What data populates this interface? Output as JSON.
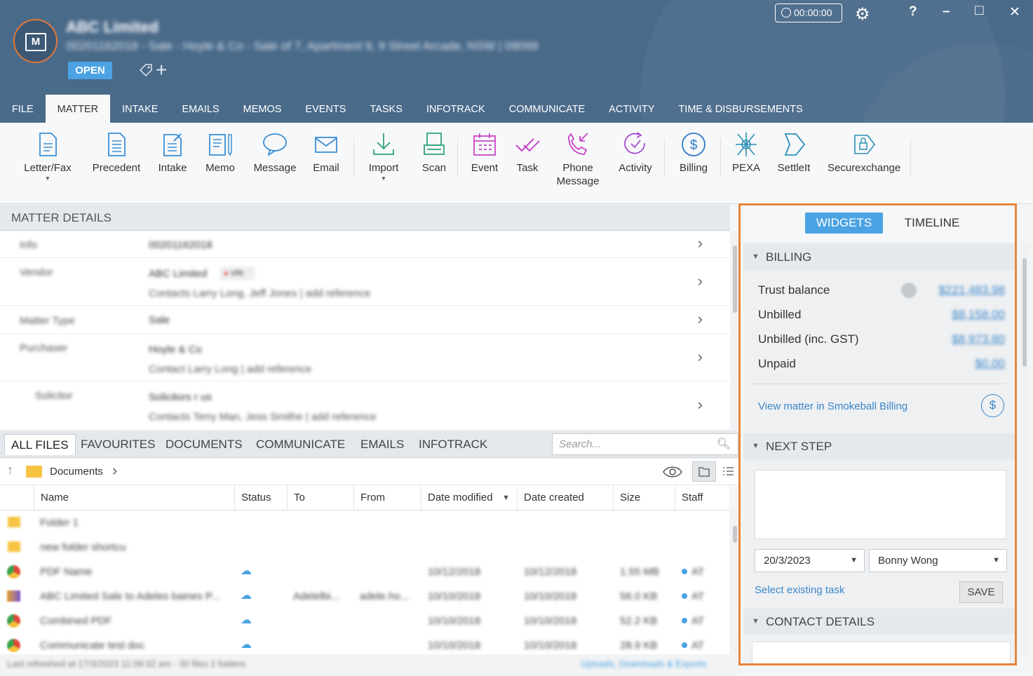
{
  "header": {
    "matter_title": "ABC Limited",
    "matter_subtitle": "00201162018 - Sale - Hoyle & Co - Sale of 7, Apartment 9, 9 Street Arcade, NSW | 09099",
    "status_badge": "OPEN",
    "timer": "00:00:00",
    "window_buttons": {
      "help": "?",
      "minimize": "–",
      "maximize": "□",
      "close": "✕"
    }
  },
  "tabs": [
    "FILE",
    "MATTER",
    "INTAKE",
    "EMAILS",
    "MEMOS",
    "EVENTS",
    "TASKS",
    "INFOTRACK",
    "COMMUNICATE",
    "ACTIVITY",
    "TIME & DISBURSEMENTS"
  ],
  "ribbon": {
    "letter_fax": "Letter/Fax",
    "precedent": "Precedent",
    "intake": "Intake",
    "memo": "Memo",
    "message": "Message",
    "email": "Email",
    "import": "Import",
    "scan": "Scan",
    "event": "Event",
    "task": "Task",
    "phone_message_1": "Phone",
    "phone_message_2": "Message",
    "activity": "Activity",
    "billing": "Billing",
    "pexa": "PEXA",
    "settleit": "SettleIt",
    "securexchange": "Securexchange"
  },
  "matter_details": {
    "heading": "MATTER DETAILS",
    "rows": [
      {
        "key": "Info",
        "value": "00201162018",
        "line2": ""
      },
      {
        "key": "Vendor",
        "value": "ABC Limited",
        "line2": "Contacts Larry Long, Jeff Jones | add reference"
      },
      {
        "key": "Matter Type",
        "value": "Sale",
        "line2": ""
      },
      {
        "key": "Purchaser",
        "value": "Hoyle & Co",
        "line2": "Contact Larry Long | add reference"
      },
      {
        "key": "Solicitor",
        "value": "Solicitors r us",
        "line2": "Contacts Terry Man, Jess Smithe | add reference"
      }
    ],
    "vendor_flag": "VRI"
  },
  "files": {
    "tabs": [
      "ALL FILES",
      "FAVOURITES",
      "DOCUMENTS",
      "COMMUNICATE",
      "EMAILS",
      "INFOTRACK"
    ],
    "search_placeholder": "Search...",
    "breadcrumb": "Documents",
    "columns": [
      "Name",
      "Status",
      "To",
      "From",
      "Date modified",
      "Date created",
      "Size",
      "Staff"
    ],
    "rows": [
      {
        "name": "Folder 1",
        "to": "",
        "from": "",
        "modified": "",
        "created": "",
        "size": "",
        "staff": ""
      },
      {
        "name": "new folder shortcu",
        "to": "",
        "from": "",
        "modified": "",
        "created": "",
        "size": "",
        "staff": ""
      },
      {
        "name": "PDF Name",
        "to": "",
        "from": "",
        "modified": "10/12/2018",
        "created": "10/12/2018",
        "size": "1.55 MB",
        "staff": "AT"
      },
      {
        "name": "ABC Limited Sale to Adeles baines P...",
        "to": "Adelelbi...",
        "from": "adele.ho...",
        "modified": "10/10/2018",
        "created": "10/10/2018",
        "size": "56.0 KB",
        "staff": "AT"
      },
      {
        "name": "Combined PDF",
        "to": "",
        "from": "",
        "modified": "10/10/2018",
        "created": "10/10/2018",
        "size": "52.2 KB",
        "staff": "AT"
      },
      {
        "name": "Communicate test doc",
        "to": "",
        "from": "",
        "modified": "10/10/2018",
        "created": "10/10/2018",
        "size": "28.9 KB",
        "staff": "AT"
      }
    ],
    "status_left": "Last refreshed at 17/3/2023 11:09:32 am  -  30 files 2 folders",
    "status_right": "Uploads, Downloads & Exports"
  },
  "right_panel": {
    "widgets_label": "WIDGETS",
    "timeline_label": "TIMELINE",
    "billing": {
      "heading": "BILLING",
      "rows": [
        {
          "label": "Trust balance",
          "amount": "$221,483.98"
        },
        {
          "label": "Unbilled",
          "amount": "$8,158.00"
        },
        {
          "label": "Unbilled (inc. GST)",
          "amount": "$8,973.80"
        },
        {
          "label": "Unpaid",
          "amount": "$0.00"
        }
      ],
      "view_link": "View matter in Smokeball Billing"
    },
    "next_step": {
      "heading": "NEXT STEP",
      "date": "20/3/2023",
      "assignee": "Bonny Wong",
      "select_task_link": "Select existing task",
      "save_label": "SAVE"
    },
    "contact_details": {
      "heading": "CONTACT DETAILS"
    }
  },
  "colors": {
    "header_bg": "#4a6a8a",
    "accent_blue": "#4ba3e3",
    "link_blue": "#3b86c9",
    "highlight_frame": "#e8843a"
  }
}
